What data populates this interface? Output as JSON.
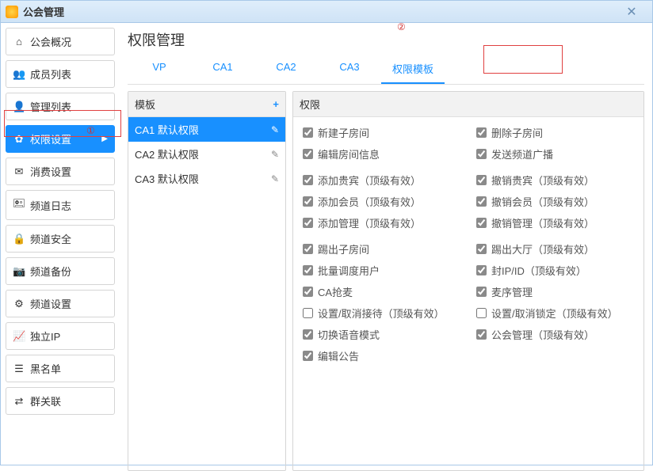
{
  "window": {
    "title": "公会管理",
    "close": "✕"
  },
  "sidebar": [
    {
      "icon": "⌂",
      "label": "公会概况"
    },
    {
      "icon": "👥",
      "label": "成员列表"
    },
    {
      "icon": "👤",
      "label": "管理列表"
    },
    {
      "icon": "✿",
      "label": "权限设置",
      "active": true
    },
    {
      "icon": "✉",
      "label": "消费设置"
    },
    {
      "icon": "🖭",
      "label": "频道日志"
    },
    {
      "icon": "🔒",
      "label": "频道安全"
    },
    {
      "icon": "📷",
      "label": "频道备份"
    },
    {
      "icon": "⚙",
      "label": "频道设置"
    },
    {
      "icon": "📈",
      "label": "独立IP"
    },
    {
      "icon": "☰",
      "label": "黑名单"
    },
    {
      "icon": "⇄",
      "label": "群关联"
    }
  ],
  "main": {
    "heading": "权限管理",
    "tabs": [
      "VP",
      "CA1",
      "CA2",
      "CA3",
      "权限模板"
    ],
    "activeTab": 4,
    "templateHeader": "模板",
    "permHeader": "权限",
    "plus": "+",
    "editIcon": "✎",
    "templates": [
      {
        "label": "CA1 默认权限",
        "selected": true
      },
      {
        "label": "CA2 默认权限"
      },
      {
        "label": "CA3 默认权限"
      }
    ],
    "permGroups": [
      [
        {
          "label": "新建子房间",
          "checked": true
        },
        {
          "label": "删除子房间",
          "checked": true
        },
        {
          "label": "编辑房间信息",
          "checked": true
        },
        {
          "label": "发送频道广播",
          "checked": true
        }
      ],
      [
        {
          "label": "添加贵宾（顶级有效）",
          "checked": true
        },
        {
          "label": "撤销贵宾（顶级有效）",
          "checked": true
        },
        {
          "label": "添加会员（顶级有效）",
          "checked": true
        },
        {
          "label": "撤销会员（顶级有效）",
          "checked": true
        },
        {
          "label": "添加管理（顶级有效）",
          "checked": true
        },
        {
          "label": "撤销管理（顶级有效）",
          "checked": true
        }
      ],
      [
        {
          "label": "踢出子房间",
          "checked": true
        },
        {
          "label": "踢出大厅（顶级有效）",
          "checked": true
        },
        {
          "label": "批量调度用户",
          "checked": true
        },
        {
          "label": "封IP/ID（顶级有效）",
          "checked": true
        },
        {
          "label": "CA抢麦",
          "checked": true
        },
        {
          "label": "麦序管理",
          "checked": true
        },
        {
          "label": "设置/取消接待（顶级有效）",
          "checked": false
        },
        {
          "label": "设置/取消锁定（顶级有效）",
          "checked": false
        },
        {
          "label": "切换语音模式",
          "checked": true
        },
        {
          "label": "公会管理（顶级有效）",
          "checked": true
        },
        {
          "label": "编辑公告",
          "checked": true
        }
      ]
    ]
  },
  "annotations": {
    "one": "①",
    "two": "②"
  }
}
